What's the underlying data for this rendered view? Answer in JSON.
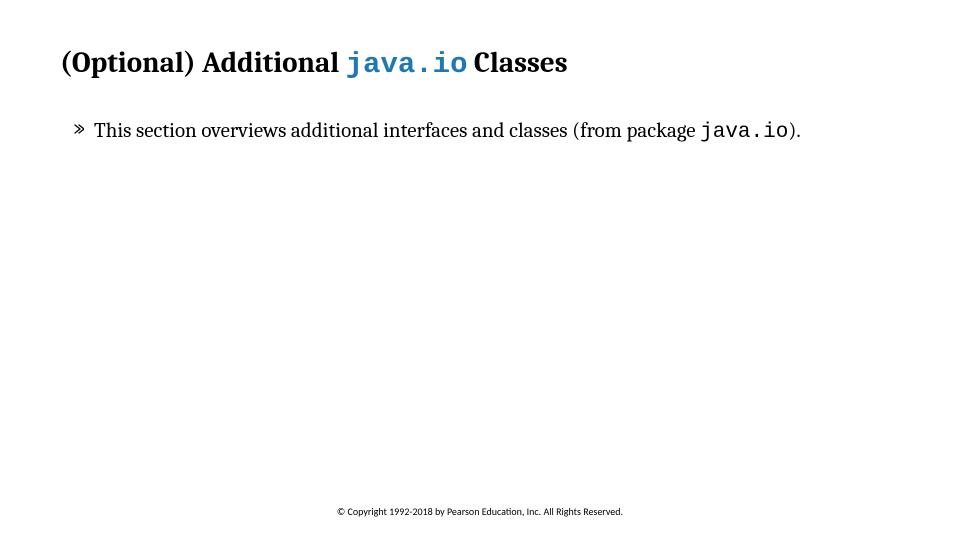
{
  "title": {
    "prefix": "(Optional) Additional ",
    "code": "java.io",
    "suffix": " Classes"
  },
  "body": {
    "bullet1": {
      "text_before_code": "This section overviews additional interfaces and classes (from package ",
      "code": "java.io",
      "text_after_code": ")."
    }
  },
  "footer": {
    "copyright": "© Copyright 1992-2018 by Pearson Education, Inc. All Rights Reserved."
  }
}
